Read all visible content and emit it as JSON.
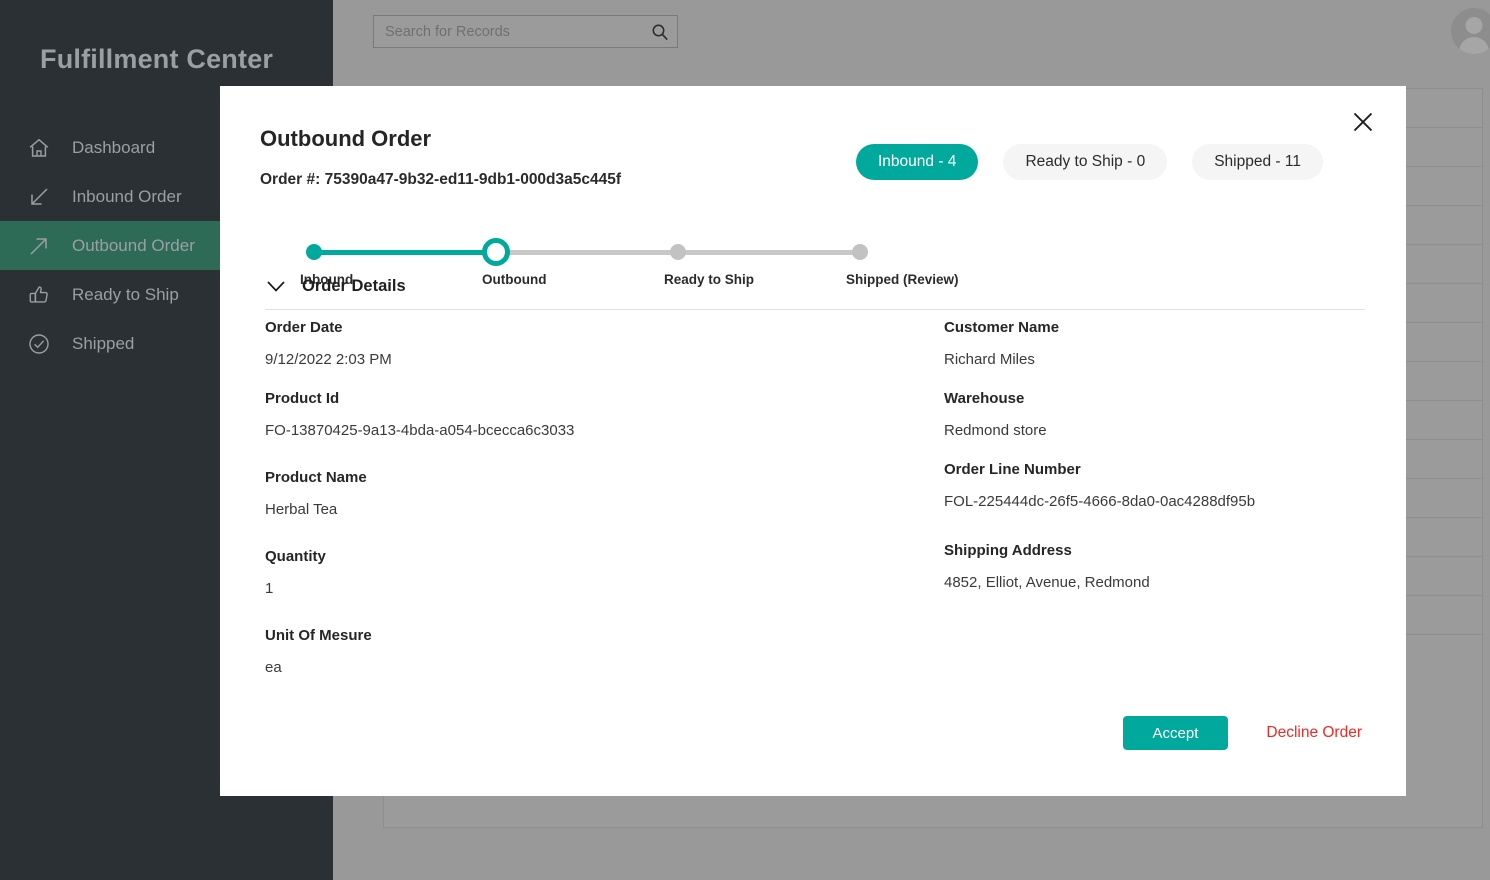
{
  "colors": {
    "accent_teal": "#01a99c",
    "sidebar_bg": "#2b3035",
    "sidebar_active": "#2e6b57",
    "scrim_grey": "#999999",
    "decline_red": "#ee2a24"
  },
  "sidebar": {
    "title": "Fulfillment Center",
    "items": [
      {
        "label": "Dashboard",
        "icon": "home-icon",
        "active": false
      },
      {
        "label": "Inbound Order",
        "icon": "arrow-down-left-icon",
        "active": false
      },
      {
        "label": "Outbound Order",
        "icon": "arrow-up-right-icon",
        "active": true
      },
      {
        "label": "Ready to Ship",
        "icon": "thumbs-up-icon",
        "active": false
      },
      {
        "label": "Shipped",
        "icon": "check-circle-icon",
        "active": false
      }
    ]
  },
  "topbar": {
    "search_placeholder": "Search for Records",
    "search_value": "",
    "search_icon": "search-icon",
    "avatar_icon": "user-avatar-icon"
  },
  "modal": {
    "title": "Outbound Order",
    "order_number_label": "Order #: 75390a47-9b32-ed11-9db1-000d3a5c445f",
    "close_icon": "close-icon",
    "tabs": [
      {
        "label": "Inbound - 4",
        "active": true
      },
      {
        "label": "Ready to Ship - 0",
        "active": false
      },
      {
        "label": "Shipped - 11",
        "active": false
      }
    ],
    "stepper": {
      "steps": [
        {
          "label": "Inbound",
          "state": "done"
        },
        {
          "label": "Outbound",
          "state": "current"
        },
        {
          "label": "Ready to Ship",
          "state": "todo"
        },
        {
          "label": "Shipped (Review)",
          "state": "todo"
        }
      ]
    },
    "section": {
      "label": "Order Details",
      "chevron_icon": "chevron-down-icon",
      "expanded": true
    },
    "fields_left": [
      {
        "key": "Order Date",
        "value": " 9/12/2022 2:03 PM"
      },
      {
        "key": "Product Id",
        "value": "FO-13870425-9a13-4bda-a054-bcecca6c3033"
      },
      {
        "key": "Product Name",
        "value": "Herbal Tea"
      },
      {
        "key": "Quantity",
        "value": "1"
      },
      {
        "key": "Unit Of Mesure",
        "value": "ea"
      }
    ],
    "fields_right": [
      {
        "key": "Customer Name",
        "value": " Richard Miles"
      },
      {
        "key": "Warehouse",
        "value": "Redmond store"
      },
      {
        "key": "Order Line Number",
        "value": "FOL-225444dc-26f5-4666-8da0-0ac4288df95b"
      },
      {
        "key": "Shipping Address",
        "value": "4852, Elliot, Avenue, Redmond"
      }
    ],
    "actions": {
      "accept_label": "Accept",
      "decline_label": "Decline Order"
    }
  }
}
